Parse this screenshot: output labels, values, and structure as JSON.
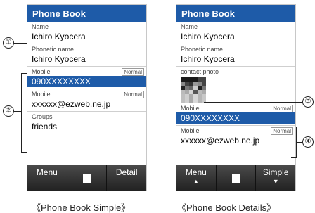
{
  "left": {
    "title": "Phone Book",
    "fields": [
      {
        "label": "Name",
        "value": "Ichiro Kyocera"
      },
      {
        "label": "Phonetic name",
        "value": "Ichiro Kyocera"
      },
      {
        "label": "Mobile",
        "badge": "Normal",
        "value": "090XXXXXXXX"
      },
      {
        "label": "Mobile",
        "badge": "Normal",
        "value": "xxxxxx@ezweb.ne.jp"
      },
      {
        "label": "Groups",
        "value": "friends"
      }
    ],
    "softkeys": {
      "left": "Menu",
      "right": "Detail"
    }
  },
  "right": {
    "title": "Phone Book",
    "fields": [
      {
        "label": "Name",
        "value": "Ichiro Kyocera"
      },
      {
        "label": "Phonetic name",
        "value": "Ichiro Kyocera"
      },
      {
        "label": "contact photo"
      },
      {
        "label": "Mobile",
        "badge": "Normal",
        "value": "090XXXXXXXX"
      },
      {
        "label": "Mobile",
        "badge": "Normal",
        "value": "xxxxxx@ezweb.ne.jp"
      }
    ],
    "softkeys": {
      "left": "Menu",
      "right": "Simple"
    }
  },
  "callouts": [
    "①",
    "②",
    "③",
    "④"
  ],
  "captions": {
    "simple": "《Phone Book Simple》",
    "details": "《Phone Book Details》"
  },
  "colors": {
    "accent": "#1e5ba8",
    "softkey_bar": "#2a2a2a"
  },
  "icons": {
    "center_key": "square-icon",
    "scroll_up": "triangle-up-icon",
    "scroll_down": "triangle-down-icon"
  }
}
